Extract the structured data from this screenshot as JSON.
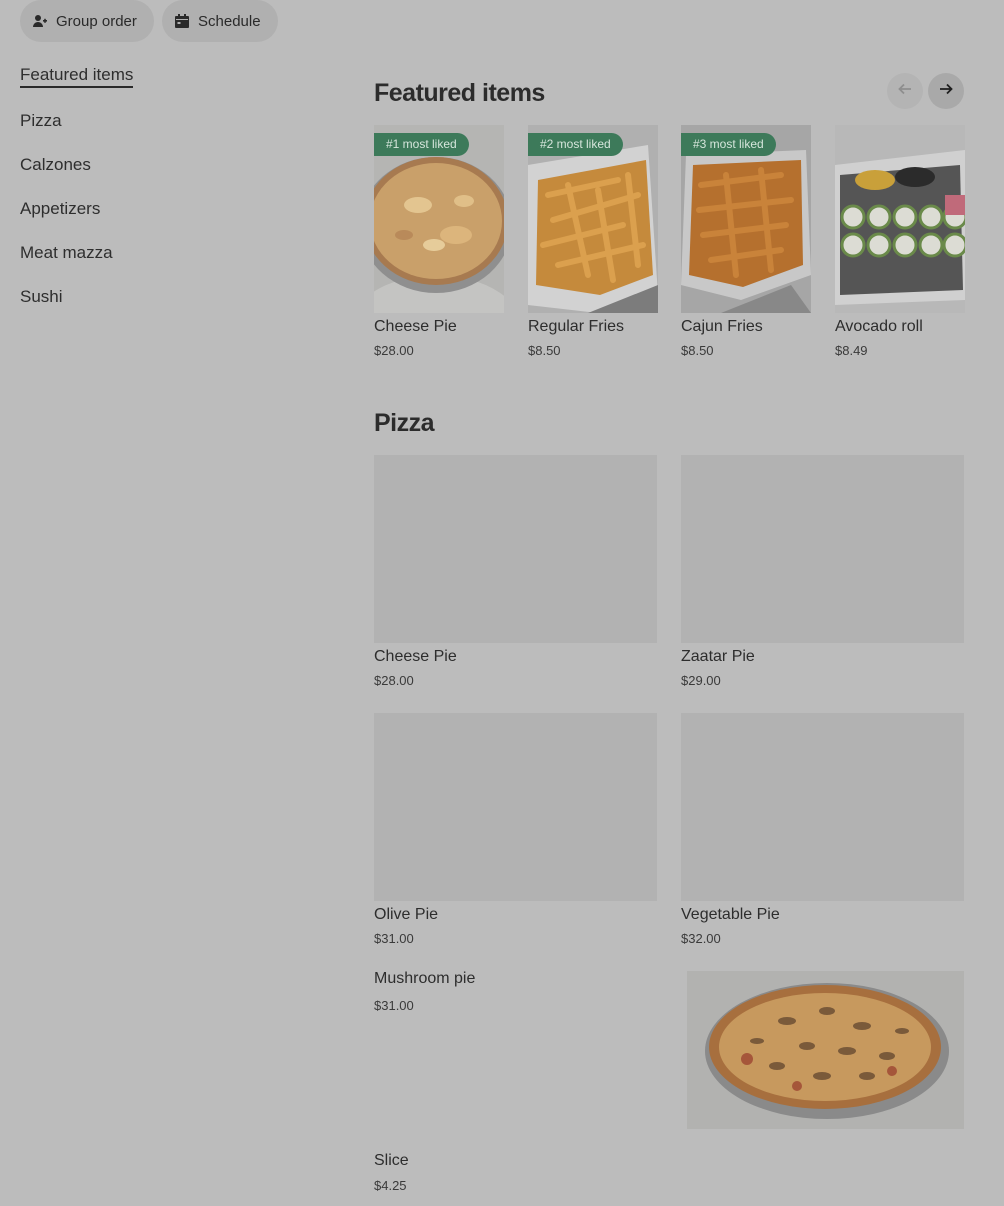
{
  "top_buttons": {
    "group_order": "Group order",
    "schedule": "Schedule"
  },
  "sidebar": {
    "items": [
      {
        "label": "Featured items",
        "active": true
      },
      {
        "label": "Pizza"
      },
      {
        "label": "Calzones"
      },
      {
        "label": "Appetizers"
      },
      {
        "label": "Meat mazza"
      },
      {
        "label": "Sushi"
      }
    ]
  },
  "featured": {
    "title": "Featured items",
    "items": [
      {
        "name": "Cheese Pie",
        "price": "$28.00",
        "badge": "#1 most liked",
        "icon": "pizza-photo"
      },
      {
        "name": "Regular Fries",
        "price": "$8.50",
        "badge": "#2 most liked",
        "icon": "fries-photo"
      },
      {
        "name": "Cajun Fries",
        "price": "$8.50",
        "badge": "#3 most liked",
        "icon": "fries-photo"
      },
      {
        "name": "Avocado roll",
        "price": "$8.49",
        "icon": "sushi-photo"
      }
    ]
  },
  "pizza": {
    "title": "Pizza",
    "items": [
      {
        "name": "Cheese Pie",
        "price": "$28.00"
      },
      {
        "name": "Zaatar Pie",
        "price": "$29.00"
      },
      {
        "name": "Olive Pie",
        "price": "$31.00"
      },
      {
        "name": "Vegetable Pie",
        "price": "$32.00"
      },
      {
        "name": "Mushroom pie",
        "price": "$31.00",
        "icon": "mushroom-pizza-photo"
      },
      {
        "name": "Slice",
        "price": "$4.25"
      }
    ]
  },
  "colors": {
    "overlay_bg": "#bcbcbc",
    "badge_green": "#3d7a5a"
  }
}
